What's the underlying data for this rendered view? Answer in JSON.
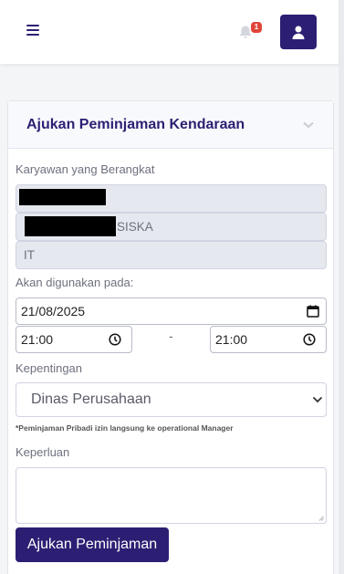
{
  "header": {
    "notification_count": "1",
    "accent_color": "#2c1f73",
    "badge_color": "#e0453a",
    "icons": [
      "hamburger-menu-icon",
      "bell-icon",
      "user-icon"
    ]
  },
  "card": {
    "title": "Ajukan Peminjaman Kendaraan"
  },
  "form": {
    "employee_label": "Karyawan yang Berangkat",
    "employee_id": "",
    "employee_name_suffix": "SISKA",
    "department": "IT",
    "date_label": "Akan digunakan pada:",
    "date_value": "21/08/2025",
    "time_start": "21:00",
    "time_end": "21:00",
    "time_separator": "-",
    "purpose_type_label": "Kepentingan",
    "purpose_type_value": "Dinas Perusahaan",
    "note": "*Peminjaman Pribadi izin langsung ke operational Manager",
    "purpose_label": "Keperluan",
    "purpose_value": "",
    "submit_label": "Ajukan Peminjaman"
  }
}
